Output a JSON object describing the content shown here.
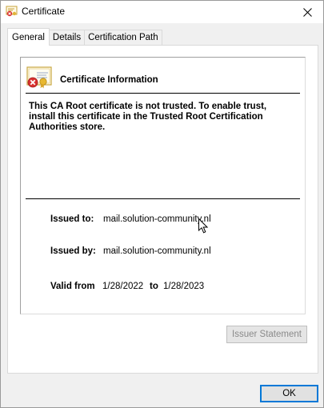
{
  "window": {
    "title": "Certificate"
  },
  "tabs": [
    {
      "label": "General",
      "active": true
    },
    {
      "label": "Details",
      "active": false
    },
    {
      "label": "Certification Path",
      "active": false
    }
  ],
  "general": {
    "header": "Certificate Information",
    "warning": "This CA Root certificate is not trusted. To enable trust, install this certificate in the Trusted Root Certification Authorities store.",
    "issued_to_label": "Issued to:",
    "issued_to_value": "mail.solution-community.nl",
    "issued_by_label": "Issued by:",
    "issued_by_value": "mail.solution-community.nl",
    "valid_from_label": "Valid from",
    "valid_from_value": "1/28/2022",
    "valid_to_label": "to",
    "valid_to_value": "1/28/2023",
    "issuer_statement_label": "Issuer Statement",
    "issuer_statement_enabled": false
  },
  "footer": {
    "ok_label": "OK"
  },
  "icons": {
    "title": "certificate-icon",
    "header": "certificate-error-icon",
    "close": "close-icon",
    "cursor": "mouse-cursor-icon"
  },
  "colors": {
    "accent": "#0078d7",
    "error": "#d9312f",
    "disabled_text": "#8a8a8a"
  }
}
